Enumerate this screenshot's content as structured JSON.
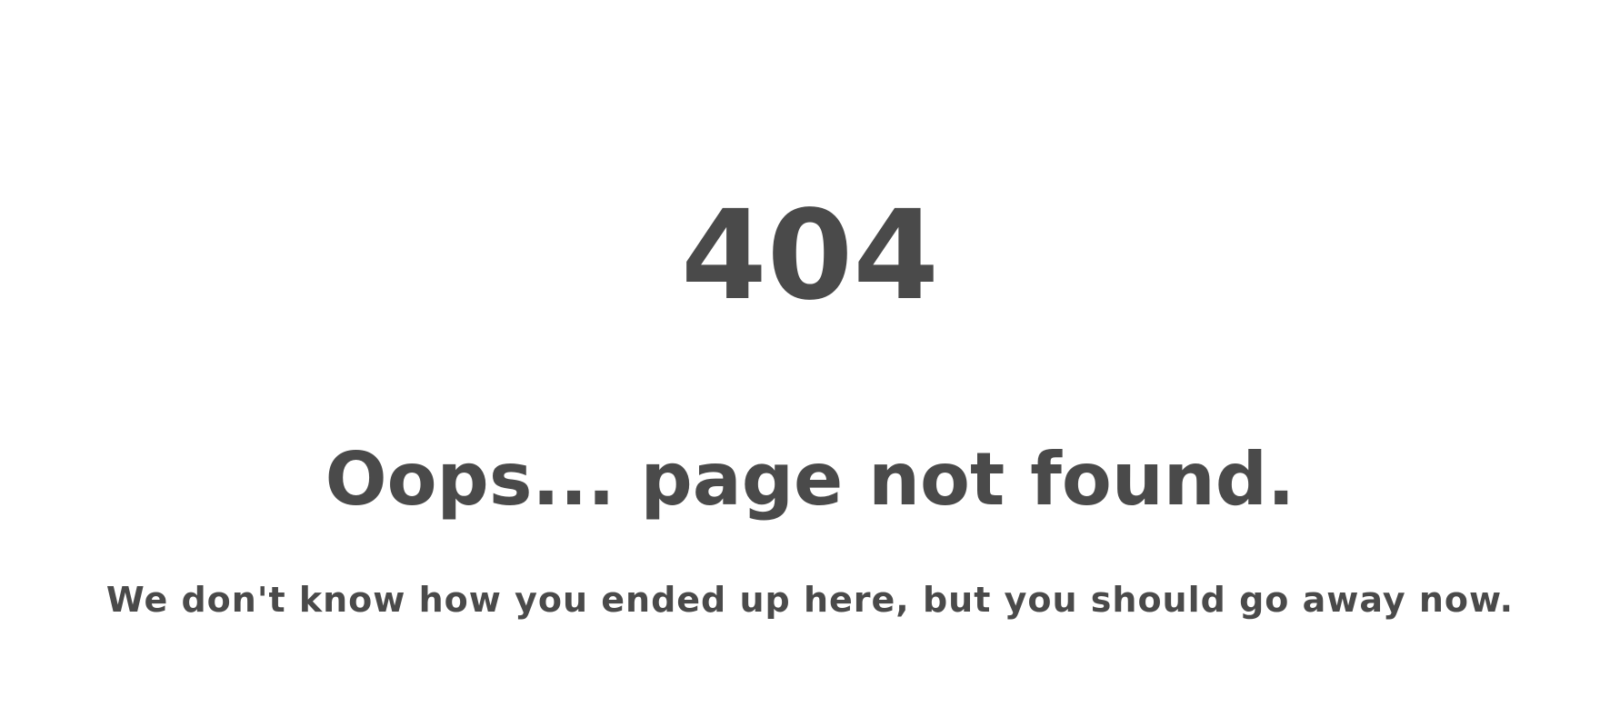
{
  "error": {
    "code": "404",
    "headline": "Oops... page not found.",
    "message": "We don't know how you ended up here, but you should go away now."
  },
  "colors": {
    "text": "#4a4a4a",
    "background": "#ffffff"
  }
}
